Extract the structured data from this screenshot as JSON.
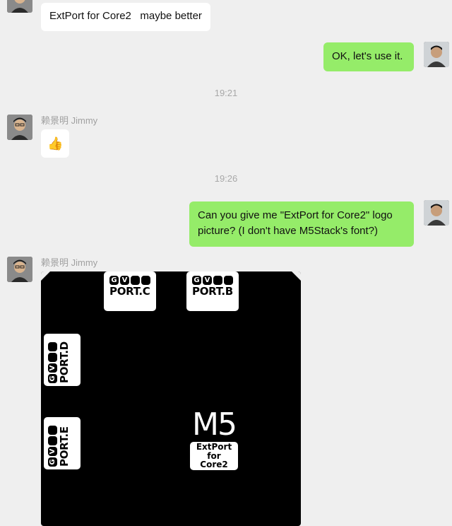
{
  "messages": {
    "m1": {
      "text": "ExtPort for Core2   maybe better"
    },
    "m2": {
      "text": "OK, let's use it."
    },
    "t1": {
      "text": "19:21"
    },
    "m3": {
      "sender": "赖景明 Jimmy",
      "emoji": "👍"
    },
    "t2": {
      "text": "19:26"
    },
    "m4": {
      "line1": "Can you give me \"ExtPort for Core2\" logo",
      "line2": "picture? (I don't have M5Stack's font?)"
    },
    "m5": {
      "sender": "赖景明 Jimmy"
    }
  },
  "logo": {
    "port_c": {
      "pins": [
        "G",
        "V",
        "",
        ""
      ],
      "label": "PORT.C"
    },
    "port_b": {
      "pins": [
        "G",
        "V",
        "",
        ""
      ],
      "label": "PORT.B"
    },
    "port_d": {
      "pins": [
        "G",
        "V",
        "",
        ""
      ],
      "label": "PORT.D"
    },
    "port_e": {
      "pins": [
        "G",
        "V",
        "",
        ""
      ],
      "label": "PORT.E"
    },
    "m5_text": "M5",
    "tag_line1": "ExtPort",
    "tag_line2": "for",
    "tag_line3": "Core2"
  },
  "colors": {
    "background": "#efefef",
    "bubble_green": "#95ec69",
    "bubble_white": "#ffffff",
    "board": "#000000"
  }
}
